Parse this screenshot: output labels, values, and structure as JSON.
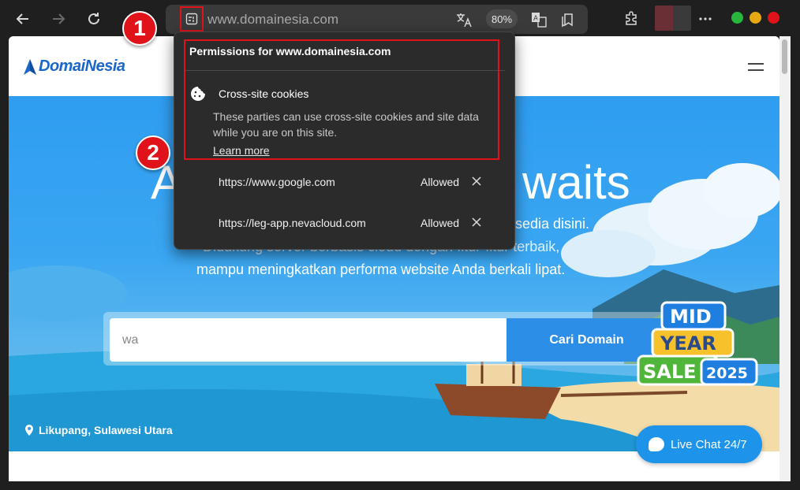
{
  "browser": {
    "url": "www.domainesia.com",
    "zoom": "80%",
    "icons": [
      "back-icon",
      "forward-icon",
      "refresh-icon",
      "site-info-icon",
      "translate-icon",
      "reader-mode-icon",
      "collections-icon",
      "extensions-icon",
      "more-icon"
    ]
  },
  "popup": {
    "title": "Permissions for www.domainesia.com",
    "section_heading": "Cross-site cookies",
    "description": "These parties can use cross-site cookies and site data while you are on this site.",
    "learn_more": "Learn more",
    "sites": [
      {
        "url": "https://www.google.com",
        "status": "Allowed"
      },
      {
        "url": "https://leg-app.nevacloud.com",
        "status": "Allowed"
      }
    ]
  },
  "annotations": {
    "step1": "1",
    "step2": "2"
  },
  "site": {
    "logo": "DomaiNesia",
    "hero_title_left": "A",
    "hero_title_right": "waits",
    "hero_line1_tail": "sedia disini.",
    "hero_line2": "Didukung server berbasis cloud dengan fitur-fitur terbaik,",
    "hero_line3": "mampu meningkatkan performa website Anda berkali lipat.",
    "search_value": "wa",
    "search_button": "Cari Domain",
    "location": "Likupang, Sulawesi Utara",
    "sale_line1": "MID",
    "sale_line2": "YEAR",
    "sale_line3": "SALE",
    "sale_year": "2025",
    "live_chat": "Live Chat 24/7"
  }
}
